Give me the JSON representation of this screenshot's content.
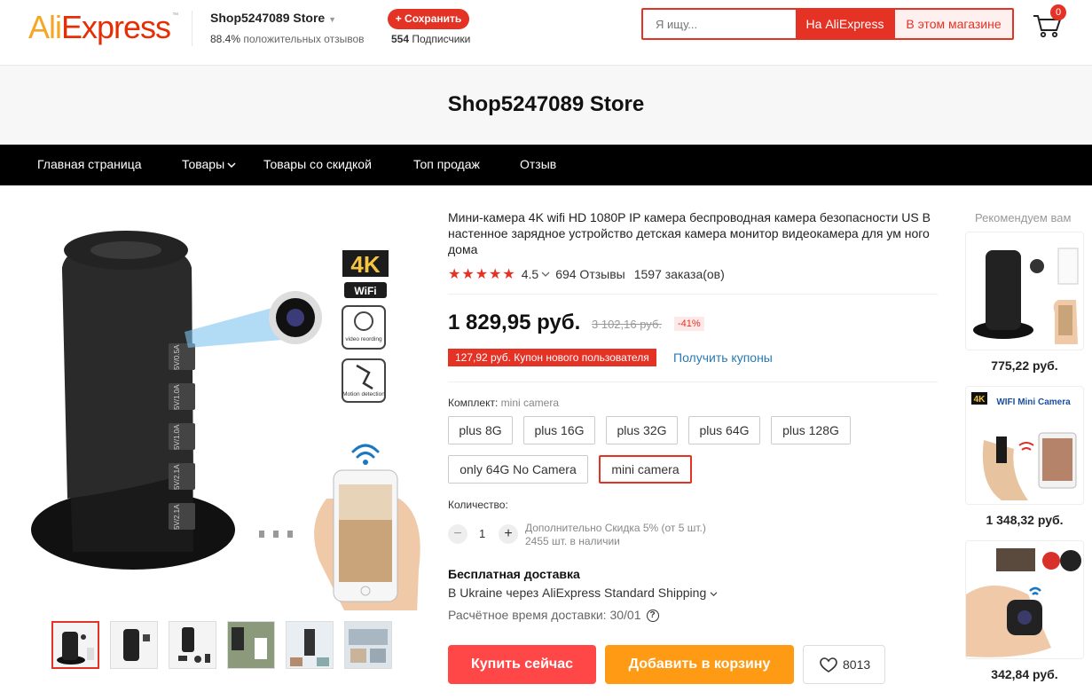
{
  "header": {
    "logo_ali": "Ali",
    "logo_express": "Express",
    "logo_tm": "™",
    "store_name": "Shop5247089 Store",
    "feedback_pct": "88.4%",
    "feedback_text": "положительных отзывов",
    "save_label": "+ Сохранить",
    "subscribers_count": "554",
    "subscribers_text": "Подписчики",
    "search_placeholder": "Я ищу...",
    "search_ali_label": "На AliExpress",
    "search_store_label": "В этом магазине",
    "cart_count": "0"
  },
  "store_banner": {
    "title": "Shop5247089 Store"
  },
  "nav": {
    "items": [
      {
        "label": "Главная страница"
      },
      {
        "label": "Товары"
      },
      {
        "label": "Товары со скидкой"
      },
      {
        "label": "Топ продаж"
      },
      {
        "label": "Отзыв"
      }
    ]
  },
  "gallery": {
    "image_text": {
      "k4": "4K",
      "wifi": "WiFi",
      "video": "video reording",
      "motion": "Motion detection",
      "ports": [
        "5V/0.5A",
        "5V/1.0A",
        "5V/1.0A",
        "5V/2.1A",
        "5V/2.1A"
      ]
    },
    "thumbnail_count": 6
  },
  "product": {
    "title": "Мини-камера 4K wifi HD 1080P IP камера беспроводная камера безопасности US В настенное зарядное устройство детская камера монитор видеокамера для ум ного дома",
    "rating_value": "4.5",
    "rating_stars": 4.5,
    "reviews": "694 Отзывы",
    "orders": "1597 заказа(ов)",
    "price": "1 829,95 руб.",
    "old_price": "3 102,16 руб.",
    "discount": "-41%",
    "coupon": "127,92 руб. Купон нового пользователя",
    "get_coupons": "Получить купоны",
    "kit_label": "Комплект:",
    "kit_value": "mini camera",
    "options": [
      "plus 8G",
      "plus 16G",
      "plus 32G",
      "plus 64G",
      "plus 128G",
      "only 64G No Camera",
      "mini camera"
    ],
    "selected_option": "mini camera",
    "qty_label": "Количество:",
    "qty_minus": "−",
    "qty_plus": "+",
    "qty_value": "1",
    "qty_discount": "Дополнительно Скидка 5% (от 5 шт.)",
    "qty_stock": "2455 шт. в наличии",
    "ship_title": "Бесплатная доставка",
    "ship_line": "В Ukraine через AliExpress Standard Shipping",
    "eta": "Расчётное время доставки: 30/01",
    "buy_now": "Купить сейчас",
    "add_to_cart": "Добавить в корзину",
    "wishlist_count": "8013"
  },
  "recommend": {
    "title": "Рекомендуем вам",
    "items": [
      {
        "price": "775,22 руб."
      },
      {
        "price": "1 348,32 руб.",
        "banner": "WIFI Mini Camera"
      },
      {
        "price": "342,84 руб."
      }
    ]
  },
  "colors": {
    "accent": "#e43225",
    "buy": "#ff4747",
    "cart": "#ff9a14",
    "link": "#2a7ab0"
  }
}
